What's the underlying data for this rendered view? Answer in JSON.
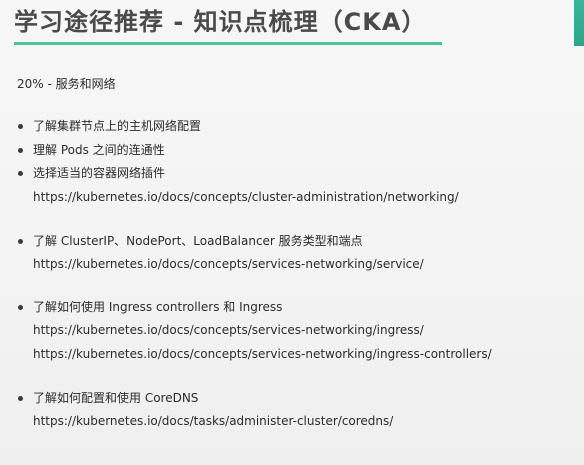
{
  "slide": {
    "title": "学习途径推荐 - 知识点梳理（CKA）",
    "section_heading": "20% - 服务和网络",
    "bullets": [
      "了解集群节点上的主机网络配置",
      "理解 Pods 之间的连通性",
      "选择适当的容器网络插件",
      "了解 ClusterIP、NodePort、LoadBalancer 服务类型和端点",
      "了解如何使用 Ingress controllers 和 Ingress",
      "了解如何配置和使用 CoreDNS"
    ],
    "links": [
      "https://kubernetes.io/docs/concepts/cluster-administration/networking/",
      "https://kubernetes.io/docs/concepts/services-networking/service/",
      "https://kubernetes.io/docs/concepts/services-networking/ingress/",
      "https://kubernetes.io/docs/concepts/services-networking/ingress-controllers/",
      "https://kubernetes.io/docs/tasks/administer-cluster/coredns/"
    ]
  },
  "colors": {
    "title_underline": "#4cc3a0",
    "right_accent": "#38b59a",
    "text": "#2b2b2b",
    "title_text": "#4a4a4a"
  }
}
